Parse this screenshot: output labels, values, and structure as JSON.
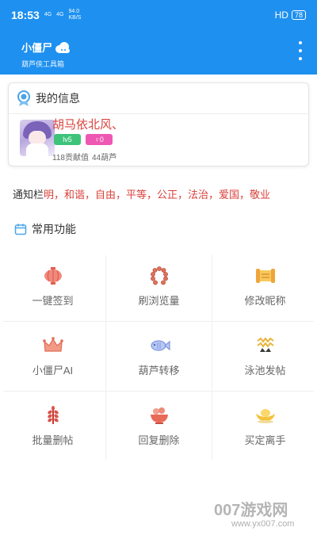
{
  "status_bar": {
    "time": "18:53",
    "signal_left": "4G",
    "signal_right": "4G",
    "speed_value": "94.0",
    "speed_unit": "KB/S",
    "hd": "HD",
    "battery": "78"
  },
  "app_bar": {
    "title": "小僵尸",
    "subtitle": "葫芦侠工具箱",
    "menu_icon": "more-vert-icon"
  },
  "profile": {
    "header": "我的信息",
    "name": "胡马依北风、",
    "level": "lv5",
    "gender_badge": "♀0",
    "contribution": "118贡献值",
    "gourds": "44葫芦",
    "colors": {
      "name": "#d9413b",
      "level": "#3ec37a",
      "gender": "#ee57b2"
    }
  },
  "notice": {
    "label": "通知栏",
    "text": "明，和谐，自由，平等，公正，法治，爱国，敬业"
  },
  "section": {
    "title": "常用功能"
  },
  "features": [
    {
      "label": "一键签到",
      "icon": "lantern-icon"
    },
    {
      "label": "刷浏览量",
      "icon": "beads-icon"
    },
    {
      "label": "修改昵称",
      "icon": "scroll-icon"
    },
    {
      "label": "小僵尸AI",
      "icon": "crown-icon"
    },
    {
      "label": "葫芦转移",
      "icon": "fish-icon"
    },
    {
      "label": "泳池发帖",
      "icon": "waves-icon"
    },
    {
      "label": "批量删帖",
      "icon": "wheat-icon"
    },
    {
      "label": "回复删除",
      "icon": "bowl-icon"
    },
    {
      "label": "买定离手",
      "icon": "gold-ingot-icon"
    }
  ],
  "watermark": {
    "brand": "007游戏网",
    "url": "www.yx007.com"
  },
  "colors": {
    "primary": "#1e90f0"
  }
}
